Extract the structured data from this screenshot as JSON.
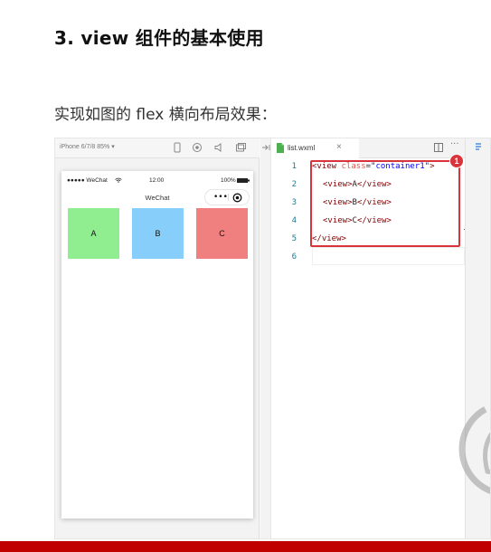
{
  "document": {
    "heading": "3. view 组件的基本使用",
    "subtext": "实现如图的 flex 横向布局效果："
  },
  "simulator": {
    "device_label": "iPhone 6/7/8 85% ▾",
    "toolbar_icons": [
      "phone-icon",
      "record-icon",
      "volume-icon",
      "window-icon"
    ],
    "status": {
      "signal": "●●●●● WeChat",
      "time": "12:00",
      "battery": "100%"
    },
    "nav_title": "WeChat",
    "capsule": {
      "dots": "•••"
    },
    "boxes": [
      {
        "label": "A",
        "color": "#90ee90"
      },
      {
        "label": "B",
        "color": "#87cefa"
      },
      {
        "label": "C",
        "color": "#f08080"
      }
    ]
  },
  "editor": {
    "tab_label": "list.wxml",
    "tab_close": "×",
    "more": "···",
    "line_numbers": [
      "1",
      "2",
      "3",
      "4",
      "5",
      "6"
    ],
    "line1": {
      "open": "<view ",
      "attr": "class",
      "eq": "=",
      "value": "\"container1\"",
      "close": ">"
    },
    "line2": {
      "open": "<view>",
      "text": "A",
      "close": "</view>"
    },
    "line3": {
      "open": "<view>",
      "text": "B",
      "close": "</view>"
    },
    "line4": {
      "open": "<view>",
      "text": "C",
      "close": "</view>"
    },
    "line5": {
      "close": "</view>"
    },
    "badge": "1"
  },
  "colors": {
    "highlight_red": "#d9333b",
    "bottom_bar": "#c00000",
    "line_number": "#237893"
  }
}
